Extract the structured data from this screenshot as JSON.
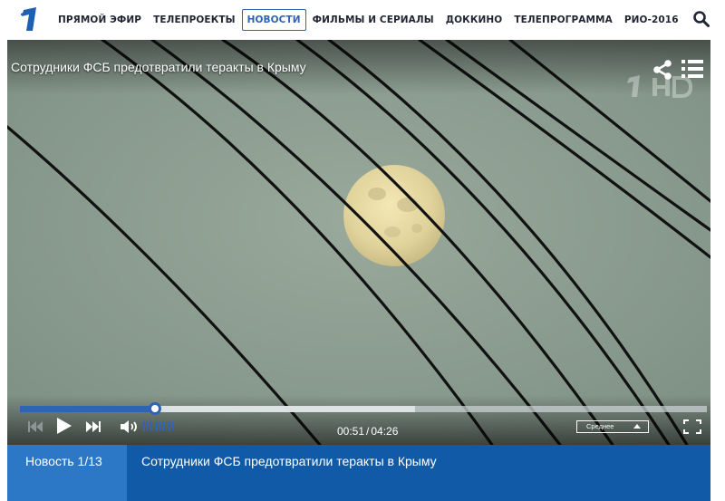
{
  "header": {
    "logo_icon": "channel-one-logo",
    "nav": [
      {
        "label": "ПРЯМОЙ ЭФИР",
        "active": false
      },
      {
        "label": "ТЕЛЕПРОЕКТЫ",
        "active": false
      },
      {
        "label": "НОВОСТИ",
        "active": true
      },
      {
        "label": "ФИЛЬМЫ И СЕРИАЛЫ",
        "active": false
      },
      {
        "label": "ДОККИНО",
        "active": false
      },
      {
        "label": "ТЕЛЕПРОГРАММА",
        "active": false
      },
      {
        "label": "РИО-2016",
        "active": false
      }
    ],
    "search_icon": "search-icon",
    "active_color": "#2d64b3"
  },
  "player": {
    "title": "Сотрудники ФСБ предотвратили теракты в Крыму",
    "share_icon": "share-icon",
    "playlist_icon": "playlist-icon",
    "time_current": "00:51",
    "time_total": "04:26",
    "time_separator": "/",
    "played_fraction": 0.197,
    "buffered_fraction": 0.575,
    "quality": "Среднее",
    "accent_color": "#2d64b3"
  },
  "info": {
    "counter": "Новость 1/13",
    "title": "Сотрудники ФСБ предотвратили теракты в Крыму",
    "bar_color": "#115aa8",
    "counter_color": "#2c78c6"
  }
}
